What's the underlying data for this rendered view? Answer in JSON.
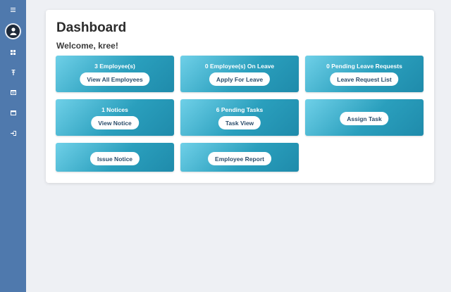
{
  "page": {
    "title": "Dashboard",
    "welcome": "Welcome, kree!"
  },
  "sidebar": {
    "icons": [
      "menu-icon",
      "user-icon",
      "dashboard-icon",
      "pin-icon",
      "calendar-icon",
      "window-icon",
      "logout-icon"
    ]
  },
  "tiles": {
    "employees": {
      "text": "3 Employee(s)",
      "button": "View All Employees"
    },
    "on_leave": {
      "text": "0 Employee(s) On Leave",
      "button": "Apply For Leave"
    },
    "leave_requests": {
      "text": "0 Pending Leave Requests",
      "button": "Leave Request List"
    },
    "notices": {
      "text": "1 Notices",
      "button": "View Notice"
    },
    "tasks": {
      "text": "6 Pending Tasks",
      "button": "Task View"
    },
    "assign": {
      "button": "Assign Task"
    },
    "issue_notice": {
      "button": "Issue Notice"
    },
    "employee_report": {
      "button": "Employee Report"
    }
  },
  "colors": {
    "sidebar": "#4f79ad",
    "tile_start": "#6fd0e8",
    "tile_end": "#1f8bab",
    "background": "#eef0f4"
  }
}
